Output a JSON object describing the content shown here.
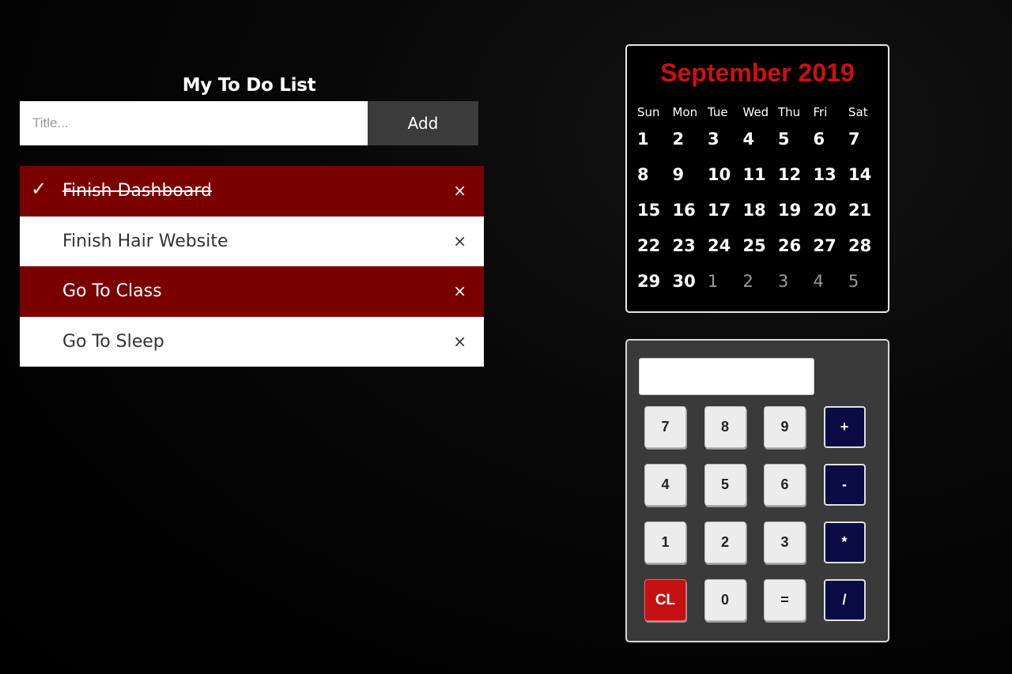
{
  "todo": {
    "title": "My To Do List",
    "input_placeholder": "Title...",
    "add_label": "Add",
    "check_glyph": "✓",
    "close_glyph": "×",
    "items": [
      {
        "label": "Finish Dashboard",
        "checked": true,
        "highlighted": true
      },
      {
        "label": "Finish Hair Website",
        "checked": false,
        "highlighted": false
      },
      {
        "label": "Go To Class",
        "checked": false,
        "highlighted": true
      },
      {
        "label": "Go To Sleep",
        "checked": false,
        "highlighted": false
      }
    ]
  },
  "calendar": {
    "title": "September 2019",
    "weekdays": [
      "Sun",
      "Mon",
      "Tue",
      "Wed",
      "Thu",
      "Fri",
      "Sat"
    ],
    "days": [
      {
        "n": "1"
      },
      {
        "n": "2"
      },
      {
        "n": "3"
      },
      {
        "n": "4"
      },
      {
        "n": "5"
      },
      {
        "n": "6"
      },
      {
        "n": "7"
      },
      {
        "n": "8"
      },
      {
        "n": "9"
      },
      {
        "n": "10"
      },
      {
        "n": "11"
      },
      {
        "n": "12"
      },
      {
        "n": "13"
      },
      {
        "n": "14"
      },
      {
        "n": "15"
      },
      {
        "n": "16"
      },
      {
        "n": "17"
      },
      {
        "n": "18"
      },
      {
        "n": "19"
      },
      {
        "n": "20"
      },
      {
        "n": "21"
      },
      {
        "n": "22"
      },
      {
        "n": "23"
      },
      {
        "n": "24"
      },
      {
        "n": "25"
      },
      {
        "n": "26"
      },
      {
        "n": "27"
      },
      {
        "n": "28"
      },
      {
        "n": "29"
      },
      {
        "n": "30"
      },
      {
        "n": "1",
        "other": true
      },
      {
        "n": "2",
        "other": true
      },
      {
        "n": "3",
        "other": true
      },
      {
        "n": "4",
        "other": true
      },
      {
        "n": "5",
        "other": true
      }
    ]
  },
  "calculator": {
    "display": "",
    "keys": [
      {
        "label": "7",
        "type": "num"
      },
      {
        "label": "8",
        "type": "num"
      },
      {
        "label": "9",
        "type": "num"
      },
      {
        "label": "+",
        "type": "op"
      },
      {
        "label": "4",
        "type": "num"
      },
      {
        "label": "5",
        "type": "num"
      },
      {
        "label": "6",
        "type": "num"
      },
      {
        "label": "-",
        "type": "op"
      },
      {
        "label": "1",
        "type": "num"
      },
      {
        "label": "2",
        "type": "num"
      },
      {
        "label": "3",
        "type": "num"
      },
      {
        "label": "*",
        "type": "op"
      },
      {
        "label": "CL",
        "type": "clear"
      },
      {
        "label": "0",
        "type": "num"
      },
      {
        "label": "=",
        "type": "num"
      },
      {
        "label": "/",
        "type": "op"
      }
    ]
  },
  "colors": {
    "todo_done_bg": "#7a0000",
    "calendar_title": "#cc1111",
    "calc_operator_bg": "#0a0a44",
    "calc_clear_bg": "#c41010"
  }
}
